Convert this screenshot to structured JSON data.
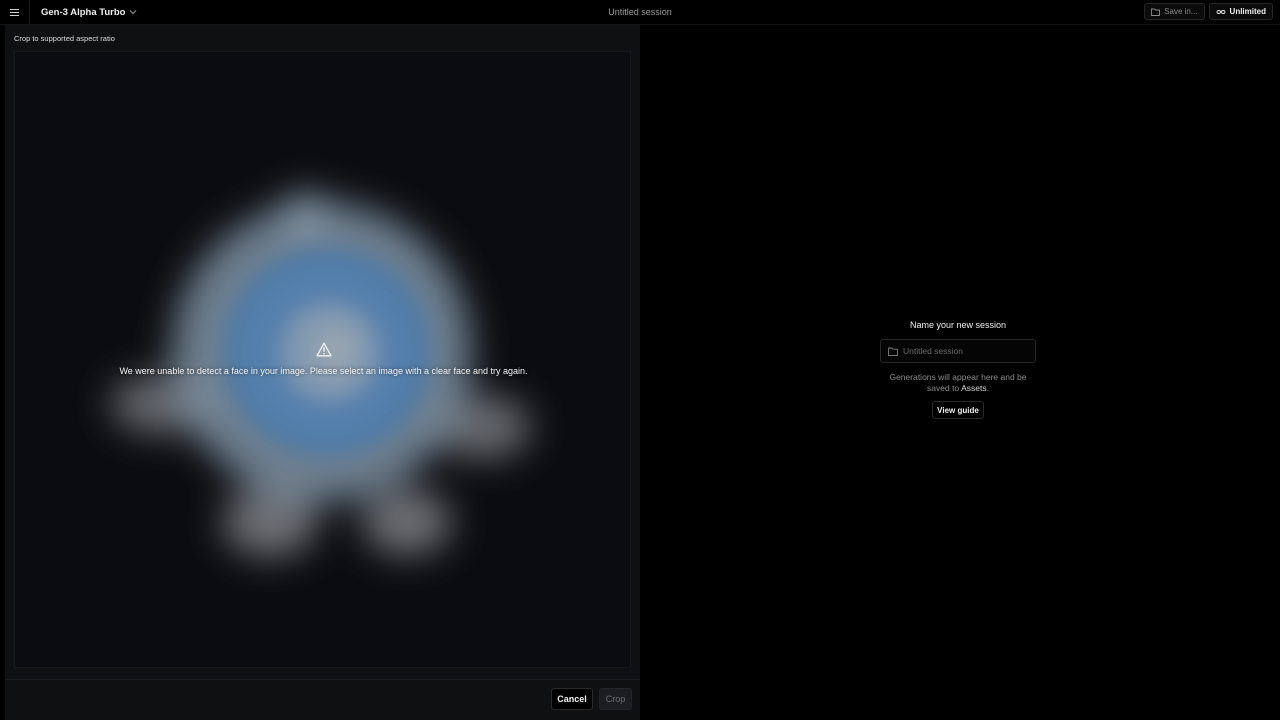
{
  "topbar": {
    "model_name": "Gen-3 Alpha Turbo",
    "session_title": "Untitled session",
    "save_label": "Save in...",
    "plan_label": "Unlimited"
  },
  "crop_panel": {
    "label": "Crop to supported aspect ratio",
    "warning_message": "We were unable to detect a face in your image. Please select an image with a clear face and try again.",
    "cancel_label": "Cancel",
    "crop_label": "Crop"
  },
  "session_panel": {
    "title": "Name your new session",
    "input_placeholder": "Untitled session",
    "input_value": "",
    "hint_prefix": "Generations will appear here and be saved to ",
    "hint_link": "Assets",
    "hint_suffix": ".",
    "guide_label": "View guide"
  },
  "icons": {
    "menu": "hamburger-menu-icon",
    "model_dropdown": "chevron-down-icon",
    "save": "folder-icon",
    "plan": "infinity-icon",
    "warning": "warning-triangle-icon",
    "session_input": "folder-icon"
  },
  "colors": {
    "background": "#000000",
    "panel": "#0f1012",
    "text_primary": "#f2f2f2",
    "text_muted": "#8a8a8a"
  }
}
